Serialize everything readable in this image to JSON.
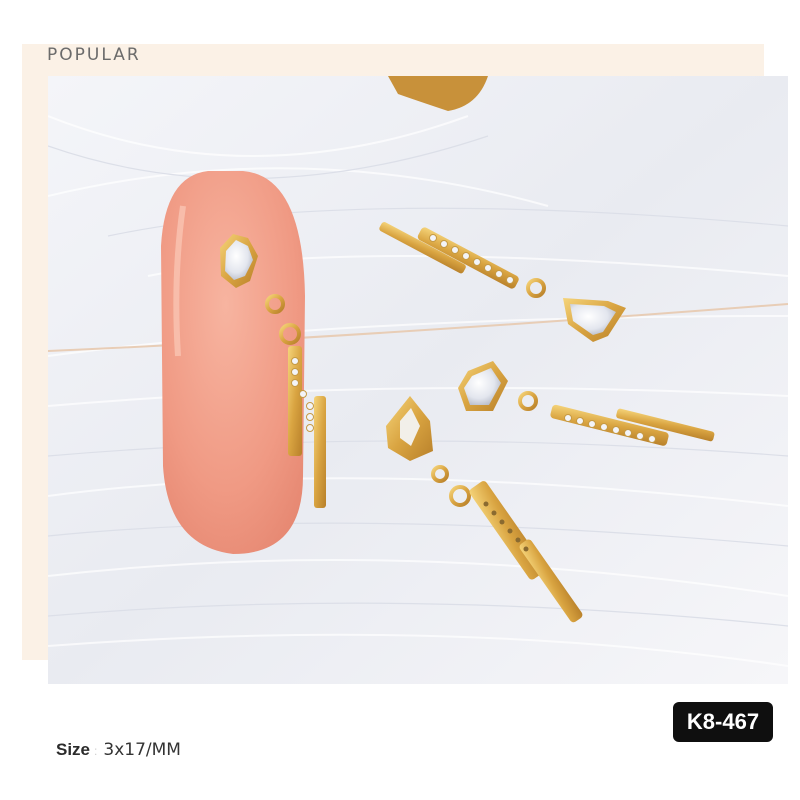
{
  "heading": "POPULAR",
  "photo": {
    "subject": "gold nail charm pendants with zircon stones on a pink nail tip over white feathers",
    "colors": {
      "feather": "#f1f2f6",
      "nail": "#f2a08b",
      "gold": "#d9a441"
    }
  },
  "badge": {
    "code": "K8-467"
  },
  "size": {
    "label": "Size",
    "separator": ":",
    "value": "3x17/MM"
  }
}
